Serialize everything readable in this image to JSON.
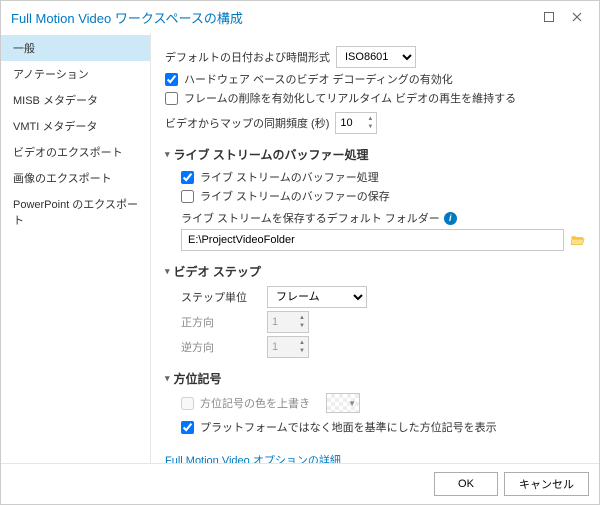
{
  "window": {
    "title": "Full Motion Video ワークスペースの構成"
  },
  "sidebar": {
    "items": [
      {
        "label": "一般",
        "selected": true
      },
      {
        "label": "アノテーション"
      },
      {
        "label": "MISB メタデータ"
      },
      {
        "label": "VMTI メタデータ"
      },
      {
        "label": "ビデオのエクスポート"
      },
      {
        "label": "画像のエクスポート"
      },
      {
        "label": "PowerPoint のエクスポート"
      }
    ]
  },
  "general": {
    "default_dt_label": "デフォルトの日付および時間形式",
    "default_dt_value": "ISO8601",
    "hw_decode": "ハードウェア ベースのビデオ デコーディングの有効化",
    "frame_drop": "フレームの削除を有効化してリアルタイム ビデオの再生を維持する",
    "sync_label": "ビデオからマップの同期頻度 (秒)",
    "sync_value": "10"
  },
  "buffer": {
    "header": "ライブ ストリームのバッファー処理",
    "opt1": "ライブ ストリームのバッファー処理",
    "opt2": "ライブ ストリームのバッファーの保存",
    "folder_label": "ライブ ストリームを保存するデフォルト フォルダー",
    "folder_value": "E:\\ProjectVideoFolder"
  },
  "step": {
    "header": "ビデオ ステップ",
    "unit_label": "ステップ単位",
    "unit_value": "フレーム",
    "forward_label": "正方向",
    "forward_value": "1",
    "backward_label": "逆方向",
    "backward_value": "1"
  },
  "orient": {
    "header": "方位記号",
    "override": "方位記号の色を上書き",
    "ground": "プラットフォームではなく地面を基準にした方位記号を表示"
  },
  "more_link": "Full Motion Video オプションの詳細",
  "footer": {
    "ok": "OK",
    "cancel": "キャンセル"
  }
}
